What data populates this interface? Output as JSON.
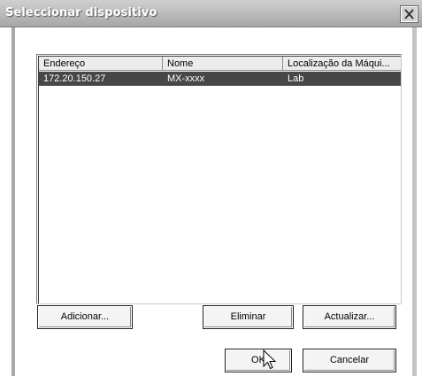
{
  "window": {
    "title": "Seleccionar dispositivo"
  },
  "listview": {
    "columns": [
      "Endereço",
      "Nome",
      "Localização da Máqui..."
    ],
    "rows": [
      {
        "address": "172.20.150.27",
        "name": "MX-xxxx",
        "location": "Lab",
        "selected": true
      }
    ]
  },
  "buttons": {
    "add": "Adicionar...",
    "delete": "Eliminar",
    "update": "Actualizar...",
    "ok": "OK",
    "cancel": "Cancelar"
  },
  "icons": {
    "close": "close-icon",
    "cursor": "mouse-pointer-icon"
  },
  "colors": {
    "selection_bg": "#474747",
    "titlebar": "#b9b9b9"
  }
}
